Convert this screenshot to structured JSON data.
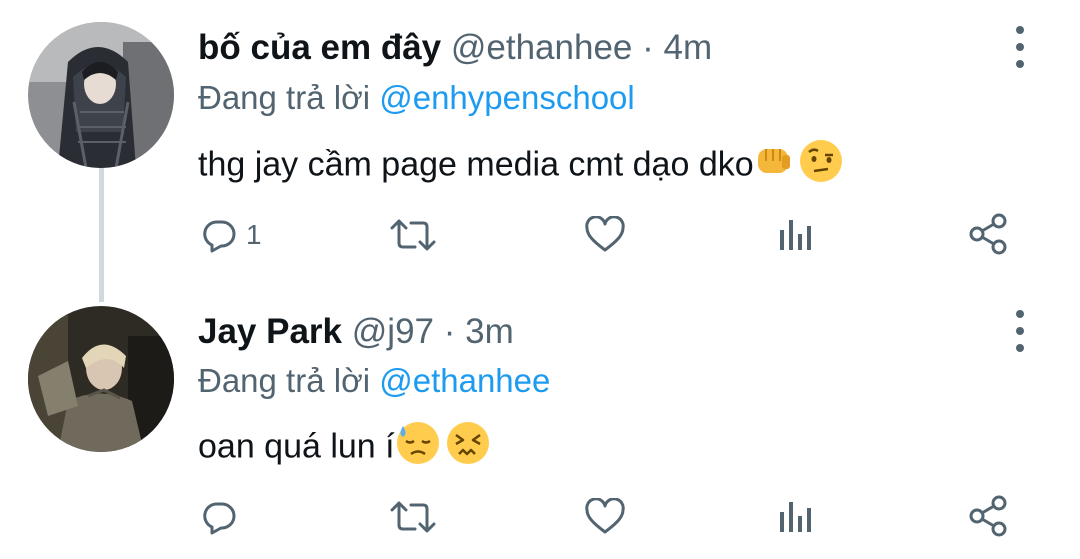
{
  "tweets": [
    {
      "display_name": "bố của em đây",
      "handle": "@ethanhee",
      "separator": "·",
      "time": "4m",
      "reply_prefix": "Đang trả lời",
      "reply_to": "@enhypenschool",
      "text": "thg jay cầm page media cmt dạo dko",
      "emojis": [
        "oncoming-fist",
        "face-with-raised-eyebrow"
      ],
      "reply_count": "1"
    },
    {
      "display_name": "Jay Park",
      "handle": "@j97",
      "separator": "·",
      "time": "3m",
      "reply_prefix": "Đang trả lời",
      "reply_to": "@ethanhee",
      "text": "oan quá lun í",
      "emojis": [
        "downcast-face-with-sweat",
        "confounded-face"
      ],
      "reply_count": ""
    }
  ],
  "icons": {
    "reply": "reply-icon",
    "retweet": "retweet-icon",
    "like": "like-icon",
    "analytics": "analytics-icon",
    "share": "share-icon",
    "more": "more-vertical-icon"
  },
  "colors": {
    "text": "#0f1419",
    "secondary": "#536471",
    "link": "#1d9bf0",
    "thread_line": "#cfd9de"
  }
}
